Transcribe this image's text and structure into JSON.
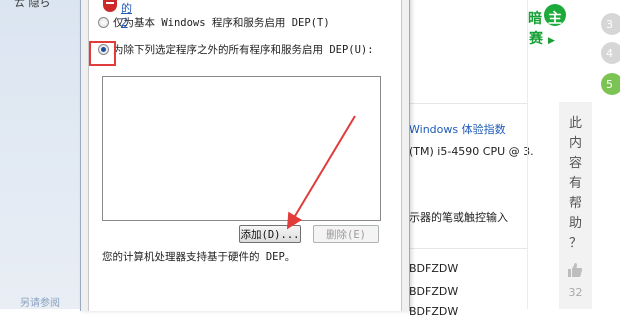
{
  "background_window": {
    "left_top_text": "ㄊ 隐ら",
    "left_bottom_link": "另请参阅"
  },
  "dialog": {
    "shield_link_text": "的2",
    "option1_label": "仅为基本 Windows 程序和服务启用 DEP(T)",
    "option2_label": "为除下列选定程序之外的所有程序和服务启用 DEP(U):",
    "add_button": "添加(D)...",
    "delete_button": "删除(E)",
    "support_text": "您的计算机处理器支持基于硬件的 DEP。"
  },
  "system_info": {
    "perf_link": "Windows 体验指数",
    "cpu_text": "(TM) i5-4590 CPU @ 3.",
    "pen_touch_text": "示器的笔或触控输入",
    "id1": "BDFZDW",
    "id2": "BDFZDW",
    "id3": "BDFZDW"
  },
  "side": {
    "logo_top": "暗",
    "logo_main": "主",
    "logo_bottom": "赛",
    "numbers": [
      "3",
      "4",
      "5"
    ],
    "helpful_chars": [
      "此",
      "内",
      "容",
      "有",
      "帮",
      "助",
      "？"
    ],
    "likes": "32"
  },
  "colors": {
    "highlight": "#e23b3b",
    "link": "#1e5bb8",
    "accent_green": "#7bc353"
  }
}
